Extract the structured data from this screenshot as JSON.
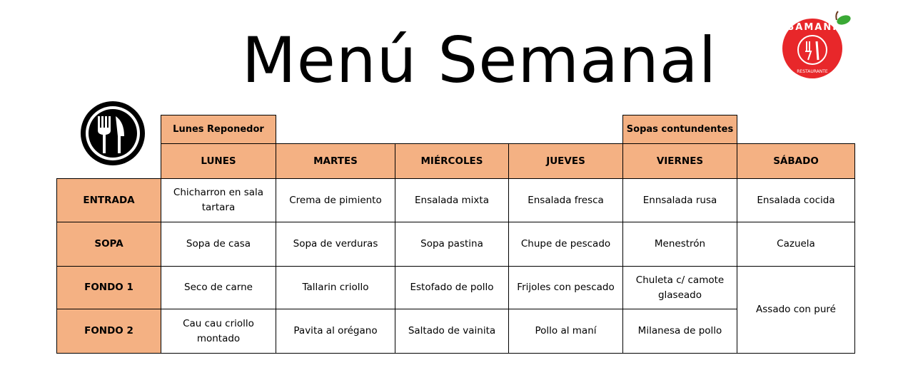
{
  "title": "Menú Semanal",
  "tags": {
    "monday": "Lunes Reponedor",
    "friday": "Sopas contundentes"
  },
  "logo": {
    "brand": "SAMANI",
    "tagline": "RESTAURANTE",
    "color": "#e8272a",
    "leaf_color": "#3aa935"
  },
  "colors": {
    "header_fill": "#f4b183"
  },
  "days": [
    "LUNES",
    "MARTES",
    "MIÉRCOLES",
    "JUEVES",
    "VIERNES",
    "SÁBADO"
  ],
  "rows": [
    {
      "label": "ENTRADA",
      "cells": [
        "Chicharron en sala tartara",
        "Crema de pimiento",
        "Ensalada mixta",
        "Ensalada fresca",
        "Ennsalada rusa",
        "Ensalada cocida"
      ]
    },
    {
      "label": "SOPA",
      "cells": [
        "Sopa de casa",
        "Sopa de verduras",
        "Sopa pastina",
        "Chupe de pescado",
        "Menestrón",
        "Cazuela"
      ]
    },
    {
      "label": "FONDO 1",
      "cells": [
        "Seco de carne",
        "Tallarin criollo",
        "Estofado de pollo",
        "Frijoles con pescado",
        "Chuleta c/ camote glaseado",
        "Assado con puré"
      ]
    },
    {
      "label": "FONDO 2",
      "cells": [
        "Cau cau criollo montado",
        "Pavita al orégano",
        "Saltado de vainita",
        "Pollo al maní",
        "Milanesa de pollo"
      ]
    }
  ]
}
